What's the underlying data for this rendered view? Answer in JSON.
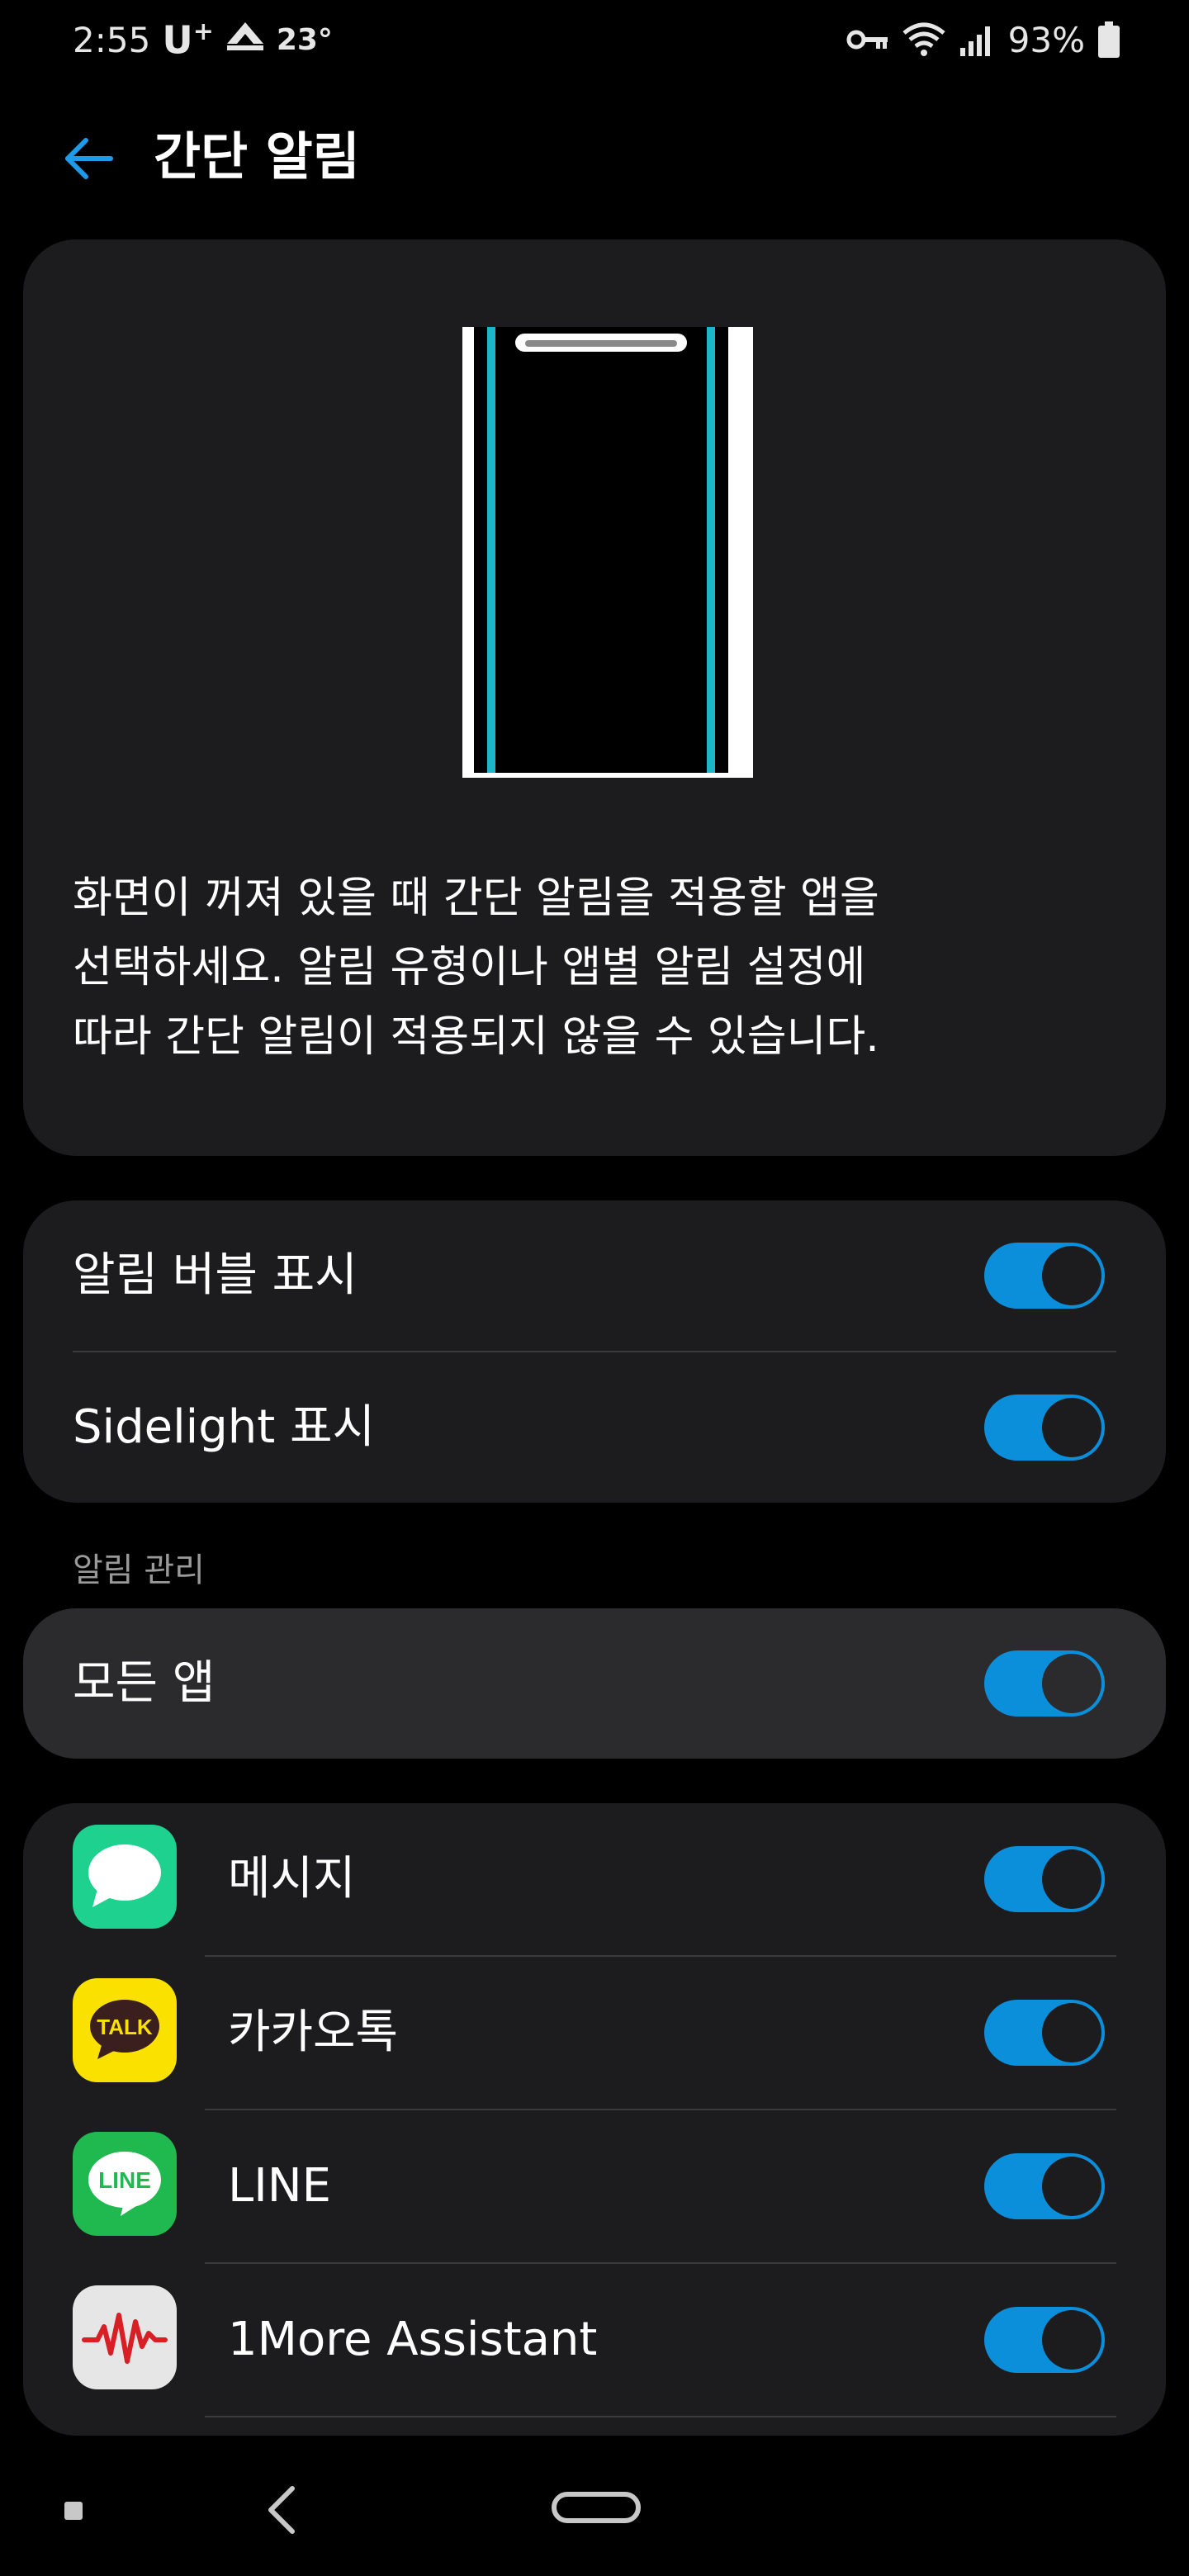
{
  "status_bar": {
    "time": "2:55",
    "carrier": "U",
    "carrier_suffix": "+",
    "temperature": "23°",
    "battery": "93%"
  },
  "header": {
    "title": "간단 알림"
  },
  "description": "화면이 꺼져 있을 때 간단 알림을 적용할 앱을\n선택하세요. 알림 유형이나 앱별 알림 설정에\n따라 간단 알림이 적용되지 않을 수 있습니다.",
  "toggles": [
    {
      "label": "알림 버블 표시",
      "on": true
    },
    {
      "label": "Sidelight 표시",
      "on": true
    }
  ],
  "section": {
    "title": "알림 관리"
  },
  "all_apps": {
    "label": "모든 앱",
    "on": true
  },
  "apps": [
    {
      "label": "메시지",
      "icon": "messages-icon",
      "on": true
    },
    {
      "label": "카카오톡",
      "icon": "kakaotalk-icon",
      "icon_text": "TALK",
      "on": true
    },
    {
      "label": "LINE",
      "icon": "line-icon",
      "icon_text": "LINE",
      "on": true
    },
    {
      "label": "1More Assistant",
      "icon": "1more-assistant-icon",
      "on": true
    }
  ],
  "colors": {
    "accent": "#0c8fdb",
    "card": "#1c1c1e",
    "highlight_card": "#2b2b2d",
    "edge_light": "#1db6c8"
  }
}
